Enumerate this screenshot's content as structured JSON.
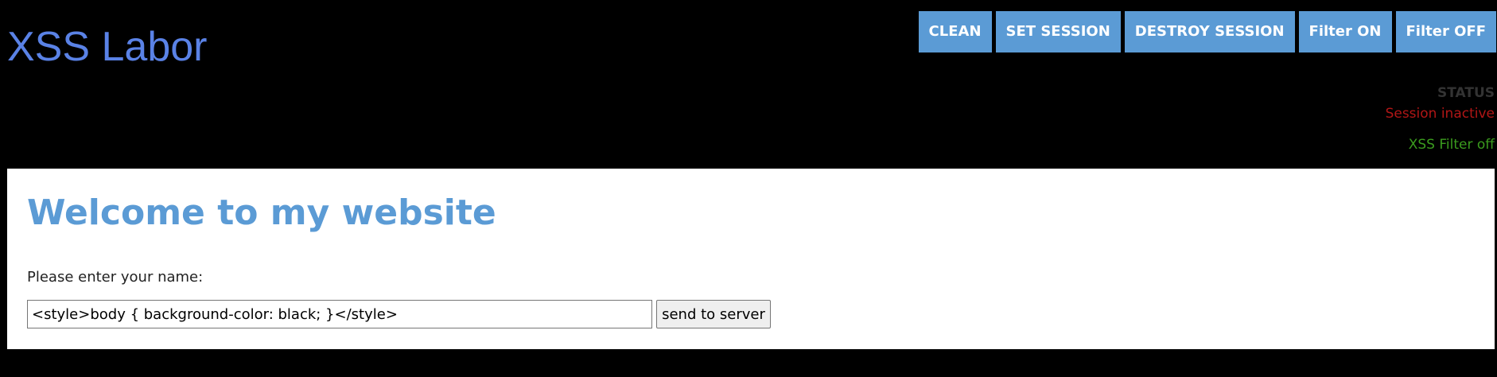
{
  "header": {
    "title": "XSS Labor"
  },
  "toolbar": {
    "buttons": [
      {
        "label": "CLEAN"
      },
      {
        "label": "SET SESSION"
      },
      {
        "label": "DESTROY SESSION"
      },
      {
        "label": "Filter ON"
      },
      {
        "label": "Filter OFF"
      }
    ]
  },
  "status": {
    "heading": "STATUS",
    "session": "Session inactive",
    "filter": "XSS Filter off"
  },
  "main": {
    "heading": "Welcome to my website",
    "name_label": "Please enter your name:",
    "name_value": "<style>body { background-color: black; }</style>",
    "submit_label": "send to server"
  },
  "colors": {
    "title": "#5a82e6",
    "button": "#5b9bd5",
    "session_inactive": "#b11616",
    "filter_off": "#3b9c1e",
    "page_background": "#000000"
  }
}
